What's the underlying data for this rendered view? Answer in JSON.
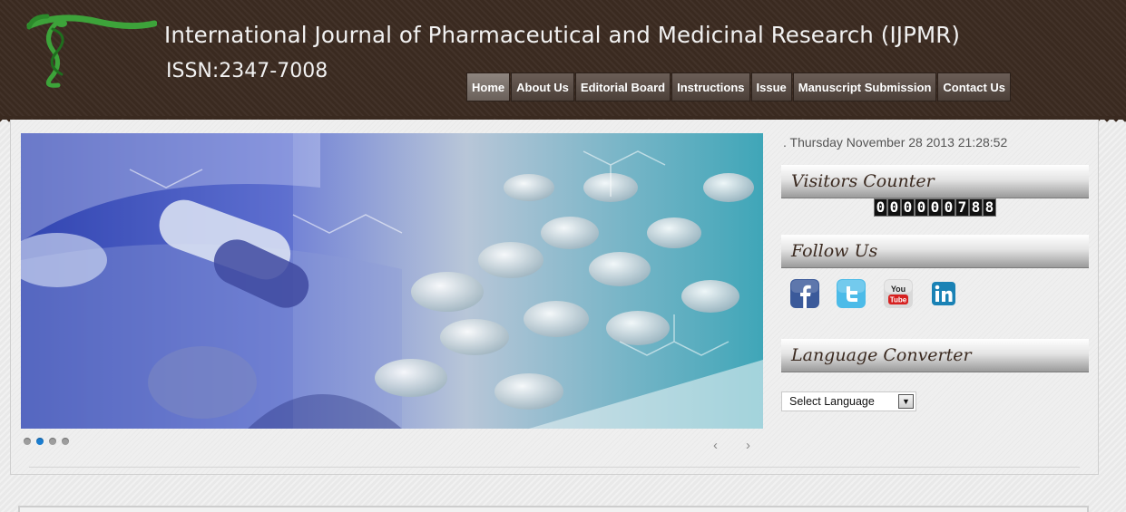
{
  "header": {
    "title": "International Journal of Pharmaceutical and Medicinal Research (IJPMR)",
    "issn": "ISSN:2347-7008"
  },
  "nav": {
    "items": [
      {
        "label": "Home",
        "active": true
      },
      {
        "label": "About Us"
      },
      {
        "label": "Editorial Board"
      },
      {
        "label": "Instructions"
      },
      {
        "label": "Issue"
      },
      {
        "label": "Manuscript Submission"
      },
      {
        "label": "Contact Us"
      }
    ]
  },
  "slider": {
    "slide_count": 4,
    "active_slide": 2,
    "prev_label": "‹",
    "next_label": "›"
  },
  "sidebar": {
    "datetime": ". Thursday November 28 2013 21:28:52",
    "visitors_heading": "Visitors Counter",
    "visitor_digits": [
      "0",
      "0",
      "0",
      "0",
      "0",
      "0",
      "7",
      "8",
      "8"
    ],
    "follow_heading": "Follow Us",
    "social_icons": [
      "facebook-icon",
      "twitter-icon",
      "youtube-icon",
      "linkedin-icon"
    ],
    "language_heading": "Language Converter",
    "language_select": "Select Language",
    "language_arrow": "▼"
  },
  "colors": {
    "header_bg": "#3a2a20",
    "active_dot": "#1a7dd0",
    "logo_green": "#3da33a"
  }
}
